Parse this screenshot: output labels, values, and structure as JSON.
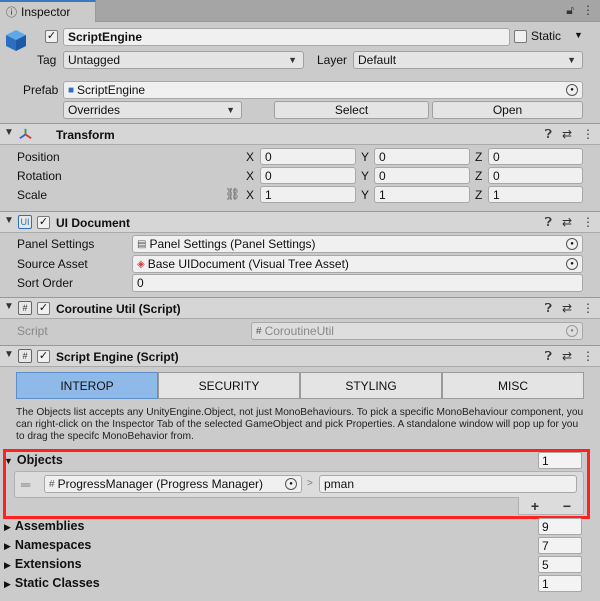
{
  "tab": {
    "title": "Inspector",
    "icons": [
      "lock-icon",
      "menu-icon"
    ]
  },
  "gameobject": {
    "active": true,
    "name": "ScriptEngine",
    "static_label": "Static",
    "static_checked": false,
    "tag_label": "Tag",
    "tag_value": "Untagged",
    "layer_label": "Layer",
    "layer_value": "Default",
    "prefab_label": "Prefab",
    "prefab_value": "ScriptEngine",
    "overrides": "Overrides",
    "select_button": "Select",
    "open_button": "Open"
  },
  "transform": {
    "title": "Transform",
    "rows": [
      {
        "label": "Position",
        "x": "0",
        "y": "0",
        "z": "0"
      },
      {
        "label": "Rotation",
        "x": "0",
        "y": "0",
        "z": "0"
      },
      {
        "label": "Scale",
        "x": "1",
        "y": "1",
        "z": "1"
      }
    ],
    "axis_x": "X",
    "axis_y": "Y",
    "axis_z": "Z"
  },
  "ui_document": {
    "title": "UI Document",
    "icon_text": "UI",
    "panel_settings_label": "Panel Settings",
    "panel_settings_value": "Panel Settings (Panel Settings)",
    "source_asset_label": "Source Asset",
    "source_asset_value": "Base UIDocument (Visual Tree Asset)",
    "sort_order_label": "Sort Order",
    "sort_order_value": "0"
  },
  "coroutine_util": {
    "title": "Coroutine Util (Script)",
    "icon_text": "#",
    "script_label": "Script",
    "script_value": "CoroutineUtil"
  },
  "script_engine": {
    "title": "Script Engine (Script)",
    "icon_text": "#",
    "tabs": [
      "INTEROP",
      "SECURITY",
      "STYLING",
      "MISC"
    ],
    "active_tab": "INTEROP",
    "help_text": "The Objects list accepts any UnityEngine.Object, not just MonoBehaviours. To pick a specific MonoBehaviour component, you can right-click on the Inspector Tab of the selected GameObject and pick Properties. A standalone window will pop up for you to drag the specifc MonoBehavior from.",
    "objects_label": "Objects",
    "objects_count": "1",
    "object_item_value": "ProgressManager (Progress Manager)",
    "object_item_alias": "pman",
    "add_button": "+",
    "remove_button": "−",
    "sections": [
      {
        "label": "Assemblies",
        "count": "9"
      },
      {
        "label": "Namespaces",
        "count": "7"
      },
      {
        "label": "Extensions",
        "count": "5"
      },
      {
        "label": "Static Classes",
        "count": "1"
      }
    ]
  },
  "colors": {
    "highlight": "#ff2020",
    "active_tab": "#8fb9e8",
    "tab_accent": "#3a79bb"
  }
}
